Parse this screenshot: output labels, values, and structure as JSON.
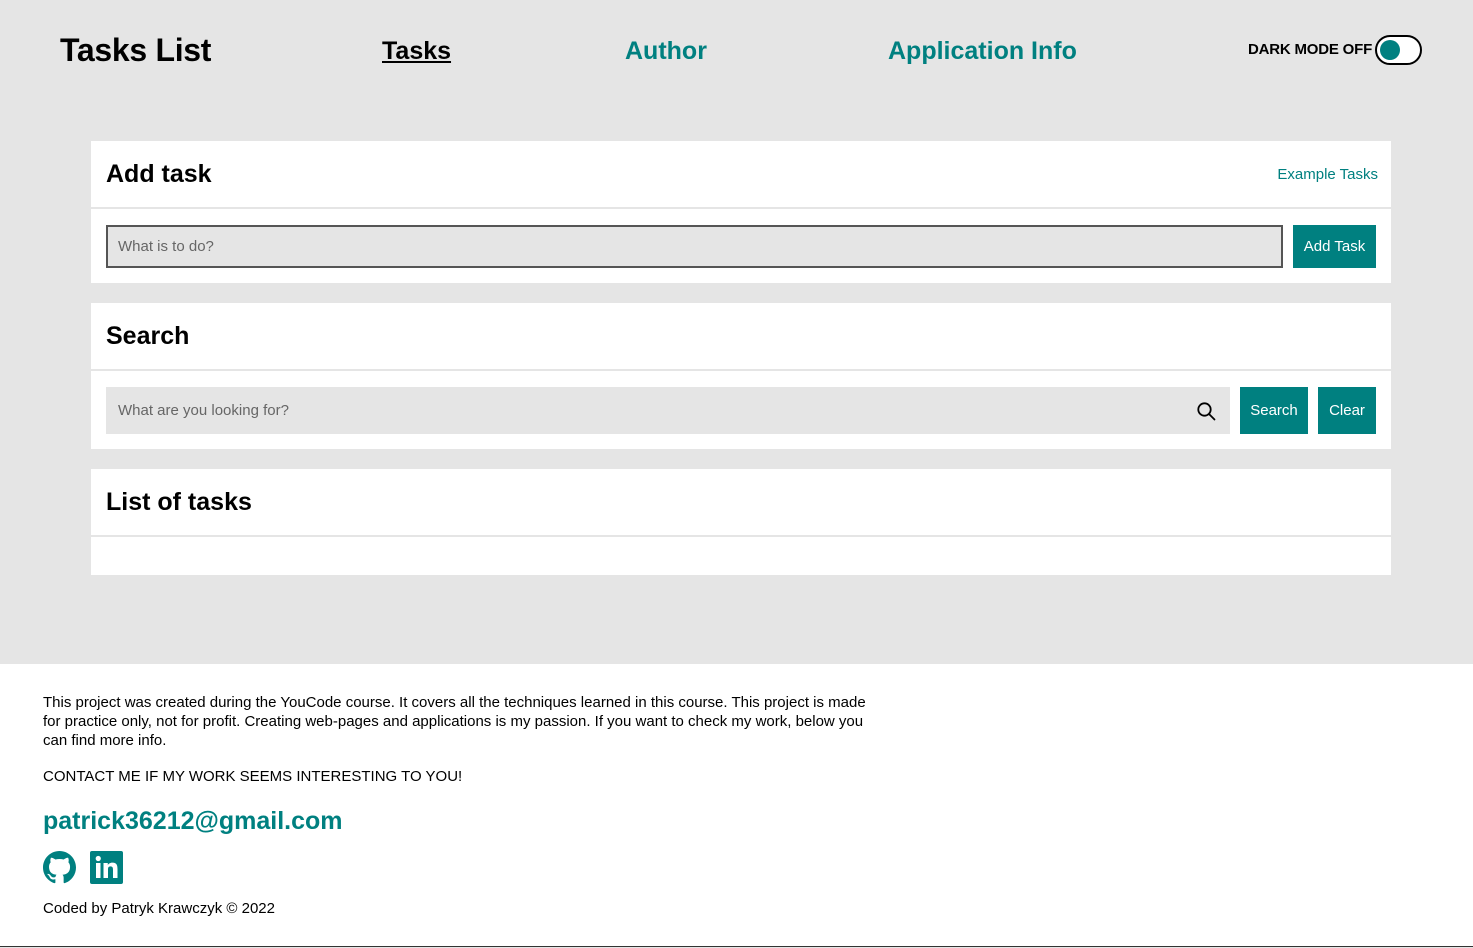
{
  "header": {
    "brand": "Tasks List",
    "nav": [
      {
        "label": "Tasks",
        "active": true
      },
      {
        "label": "Author",
        "active": false
      },
      {
        "label": "Application Info",
        "active": false
      }
    ],
    "dark_mode_label": "DARK MODE OFF"
  },
  "add_task": {
    "title": "Add task",
    "example_link": "Example Tasks",
    "input_placeholder": "What is to do?",
    "button_label": "Add Task"
  },
  "search": {
    "title": "Search",
    "input_placeholder": "What are you looking for?",
    "search_icon": "search-icon",
    "search_button": "Search",
    "clear_button": "Clear"
  },
  "task_list": {
    "title": "List of tasks",
    "items": []
  },
  "footer": {
    "description": "This project was created during the YouCode course. It covers all the techniques learned in this course. This project is made for practice only, not for profit. Creating web-pages and applications is my passion. If you want to check my work, below you can find more info.",
    "contact": "CONTACT ME IF MY WORK SEEMS INTERESTING TO YOU!",
    "email": "patrick36212@gmail.com",
    "social_icons": [
      "github-icon",
      "linkedin-icon"
    ],
    "credit": "Coded by Patryk Krawczyk © 2022"
  },
  "colors": {
    "accent": "#008080",
    "background": "#e5e5e5",
    "card": "#ffffff"
  }
}
